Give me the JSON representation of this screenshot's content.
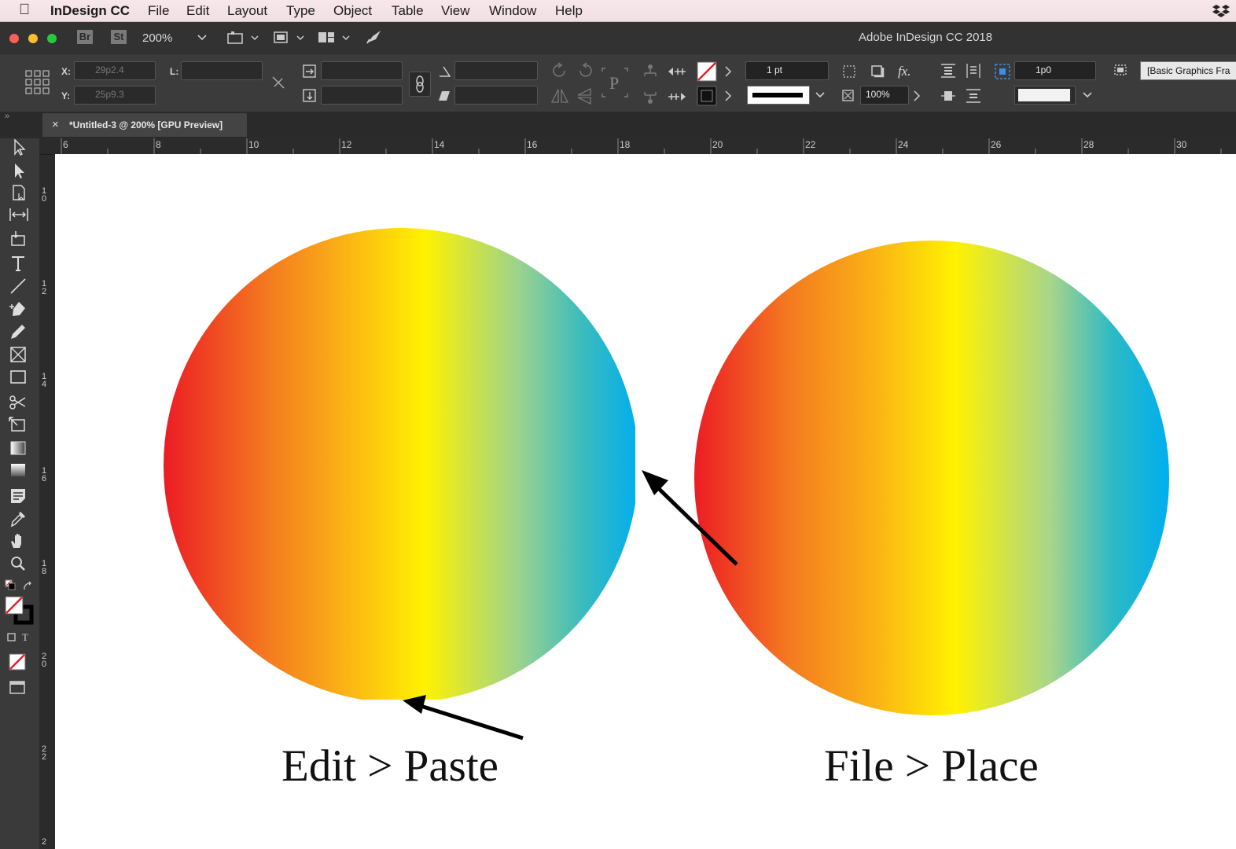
{
  "menubar": {
    "app_name": "InDesign CC",
    "items": [
      "File",
      "Edit",
      "Layout",
      "Type",
      "Object",
      "Table",
      "View",
      "Window",
      "Help"
    ]
  },
  "titlebar": {
    "window_title": "Adobe InDesign CC 2018",
    "bridge_label": "Br",
    "stock_label": "St",
    "zoom": "200%"
  },
  "control": {
    "x_label": "X:",
    "y_label": "Y:",
    "l_label": "L:",
    "x_value": "29p2.4",
    "y_value": "25p9.3",
    "stroke_weight": "1 pt",
    "opacity": "100%",
    "spacing": "1p0",
    "object_style": "[Basic Graphics Fra"
  },
  "document_tab": {
    "title": "*Untitled-3 @ 200% [GPU Preview]"
  },
  "ruler": {
    "horizontal": [
      "6",
      "8",
      "10",
      "12",
      "14",
      "16",
      "18",
      "20",
      "22",
      "24",
      "26",
      "28",
      "30"
    ],
    "vertical": [
      "10",
      "12",
      "14",
      "16",
      "18",
      "20",
      "22",
      "2"
    ]
  },
  "captions": {
    "left": "Edit > Paste",
    "right": "File > Place"
  },
  "colors": {
    "gradient": [
      "#ec1c24",
      "#f7931e",
      "#fff200",
      "#00aeef"
    ]
  }
}
